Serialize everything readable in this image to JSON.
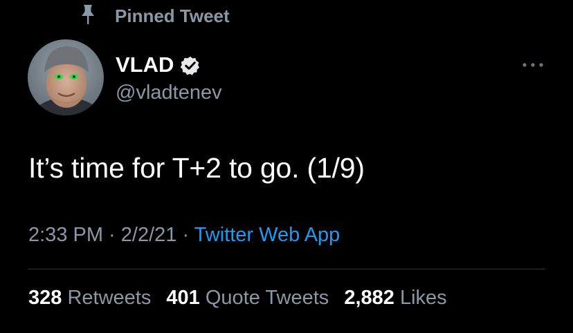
{
  "pinned": {
    "label": "Pinned Tweet",
    "icon": "pin-icon"
  },
  "author": {
    "name": "VLAD",
    "handle": "@vladtenev",
    "verified_icon": "verified-badge-icon",
    "avatar": "user-avatar"
  },
  "tweet": {
    "text": "It’s time for T+2 to go. (1/9)",
    "time": "2:33 PM",
    "separator1": " · ",
    "date": "2/2/21",
    "separator2": " · ",
    "source": "Twitter Web App"
  },
  "stats": {
    "retweets_count": "328",
    "retweets_label": "Retweets",
    "quotes_count": "401",
    "quotes_label": "Quote Tweets",
    "likes_count": "2,882",
    "likes_label": "Likes"
  },
  "colors": {
    "background": "#000000",
    "primary_text": "#ffffff",
    "secondary_text": "#8b98a5",
    "link": "#1d9bf0",
    "divider": "#2f3336"
  }
}
